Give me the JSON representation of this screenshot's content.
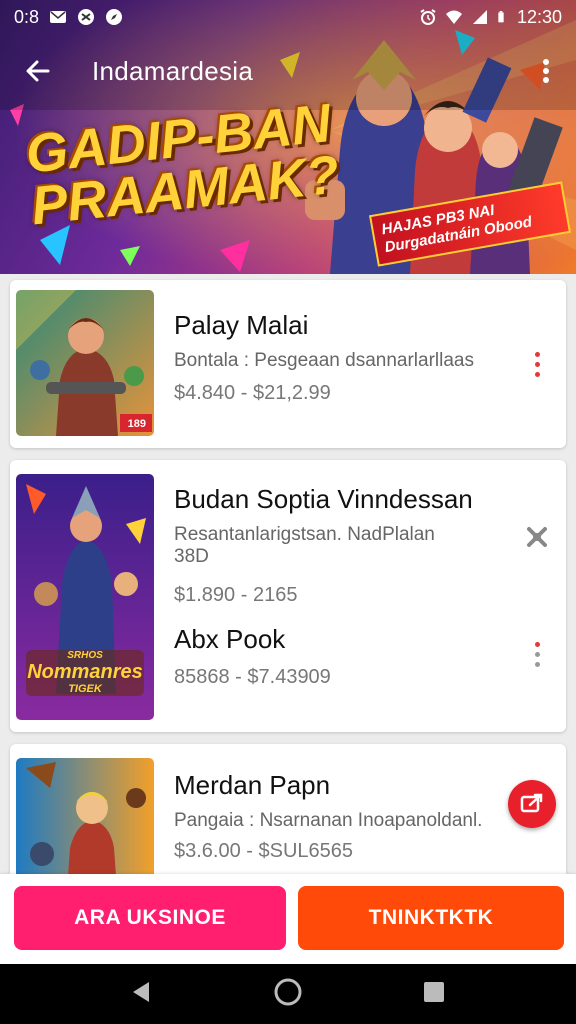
{
  "status_bar": {
    "time_left": "0:8",
    "time": "12:30"
  },
  "app_bar": {
    "title": "Indamardesia"
  },
  "hero": {
    "headline_line1": "GADIP-BAN",
    "headline_line2": "PRAAMAK?",
    "tag_line1": "HAJAS PB3 NAI",
    "tag_line2": "Durgadatnáin Obood"
  },
  "cards": [
    {
      "title": "Palay Malai",
      "subtitle": "Bontala : Pesgeaan dsannarlarllaas",
      "price": "$4.840 - $21,2.99",
      "badge": "189"
    },
    {
      "title": "Budan Soptia Vinndessan",
      "subtitle_line1": "Resantanlarigstsan. NadPlalan",
      "subtitle_line2": "38D",
      "price": "$1.890 - 2165",
      "second_title": "Abx Pook",
      "second_price": "85868 - $7.43909",
      "poster_text_line1": "SRHOS",
      "poster_text_line2": "Nommanres",
      "poster_text_line3": "TIGEK"
    },
    {
      "title": "Merdan Papn",
      "subtitle": "Pangaia : Nsarnanan Inoapanoldanl.",
      "price": "$3.6.00 - $SUL6565"
    }
  ],
  "actions": {
    "left_label": "ARA UKSINOE",
    "right_label": "TNINKTKTK"
  },
  "colors": {
    "accent_pink": "#ff1f6e",
    "accent_orange": "#ff4a0a",
    "kebab_red": "#e53935"
  }
}
